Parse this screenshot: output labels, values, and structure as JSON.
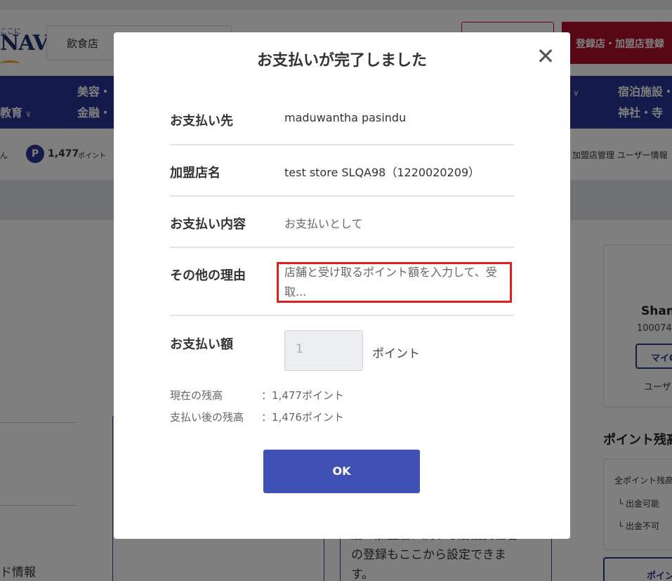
{
  "background": {
    "logo_small": "ここに",
    "logo_text": "NAVI",
    "category_select": "飲食店",
    "register_button": "登録店・加盟店登録",
    "nav": {
      "item1_line1": "美容・",
      "item1_line2": "金融・",
      "item2": "教育",
      "item3_line1": "宿泊施設・",
      "item3_line2": "神社・寺"
    },
    "user_suffix": "ん",
    "points_badge": "P",
    "points_value": "1,477",
    "points_unit": "ポイント",
    "header_links": "加盟店管理 ユーザー情報",
    "card_text": "店・加盟店に属する店舗責任者の登録もここから設定できます。",
    "sidebar": {
      "name": "Shan",
      "id": "100074",
      "button": "マイQ",
      "user_label": "ユーザ",
      "points_title": "ポイント残高",
      "all_points": "全ポイント残高",
      "withdrawable": "└ 出金可能",
      "not_withdrawable": "└ 出金不可",
      "bottom_button": "ポイン"
    },
    "left_label": "ド情報"
  },
  "modal": {
    "title": "お支払いが完了しました",
    "rows": {
      "payee_label": "お支払い先",
      "payee_value": "maduwantha pasindu",
      "store_label": "加盟店名",
      "store_value": "test store SLQA98（1220020209）",
      "content_label": "お支払い内容",
      "content_value": "お支払いとして",
      "reason_label": "その他の理由",
      "reason_value": "店舗と受け取るポイント額を入力して、受取...",
      "amount_label": "お支払い額",
      "amount_value": "1",
      "amount_unit": "ポイント"
    },
    "balance": {
      "current_label": "現在の残高",
      "current_value": "：1,477ポイント",
      "after_label": "支払い後の残高",
      "after_value": "：1,476ポイント"
    },
    "ok_label": "OK"
  },
  "colors": {
    "nav": "#283593",
    "primary_button": "#3f51b5",
    "highlight": "#e02020",
    "register": "#b10e2b"
  }
}
